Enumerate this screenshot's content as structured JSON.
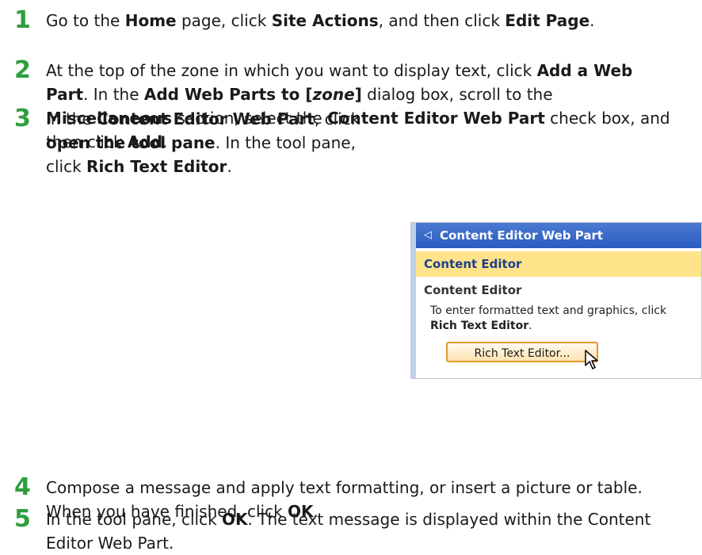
{
  "steps": [
    {
      "number": "1",
      "parts": [
        "Go to the ",
        "Home",
        " page, click ",
        "Site Actions",
        ", and then click ",
        "Edit Page",
        "."
      ]
    },
    {
      "number": "2",
      "parts": [
        "At the top of the zone in which you want to display text, click ",
        "Add a Web Part",
        ". In the ",
        "Add Web Parts to [",
        "zone",
        "]",
        " dialog box, scroll to the ",
        "Miscellaneous",
        " section, select the ",
        "Content Editor Web Part",
        " check box, and then click ",
        "Add",
        "."
      ]
    },
    {
      "number": "3",
      "parts": [
        "In the ",
        "Content Editor Web Part",
        ", click ",
        "open the tool pane",
        ". In the tool pane, click ",
        "Rich Text Editor",
        "."
      ]
    },
    {
      "number": "4",
      "parts": [
        "Compose a message and apply text formatting, or insert a picture or table. When you have finished, click ",
        "OK",
        "."
      ]
    },
    {
      "number": "5",
      "parts": [
        "In the tool pane, click ",
        "OK",
        ". The text message is displayed within the Content Editor Web Part."
      ]
    }
  ],
  "screenshot": {
    "title_arrow": "◁",
    "title": "Content Editor Web Part",
    "band": "Content Editor",
    "heading": "Content Editor",
    "description_prefix": "To enter formatted text and graphics, click ",
    "description_bold": "Rich Text Editor",
    "description_suffix": ".",
    "button_label": "Rich Text Editor...",
    "colors": {
      "title_bar": "#2b5cc0",
      "selected_band": "#ffe38a",
      "button_border": "#e49a2a",
      "step_number": "#2e9f3d"
    }
  }
}
